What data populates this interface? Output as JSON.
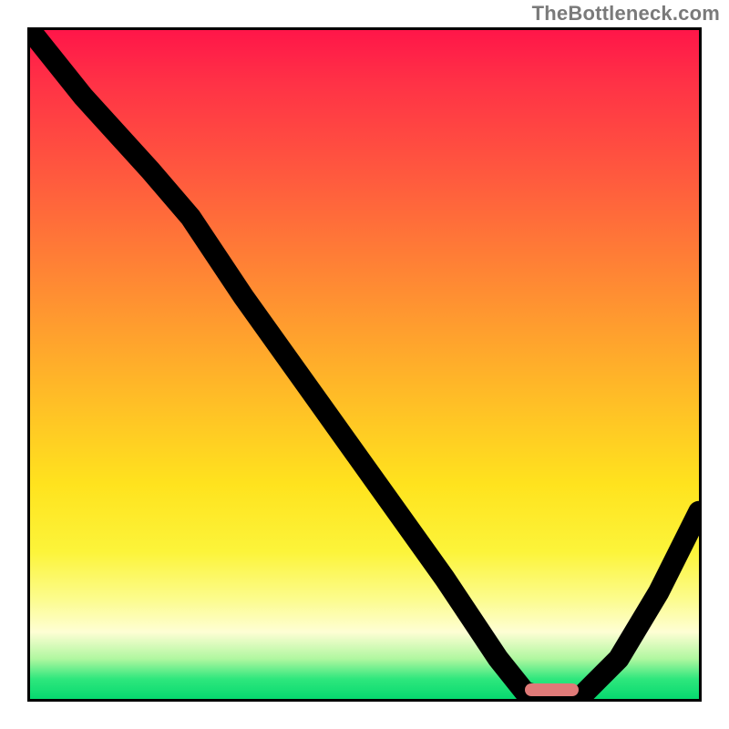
{
  "watermark": "TheBottleneck.com",
  "chart_data": {
    "type": "line",
    "title": "",
    "xlabel": "",
    "ylabel": "",
    "xlim": [
      0,
      100
    ],
    "ylim": [
      0,
      100
    ],
    "series": [
      {
        "name": "curve",
        "x": [
          0,
          8,
          18,
          24,
          32,
          42,
          52,
          62,
          70,
          74,
          78,
          82,
          88,
          94,
          100
        ],
        "values": [
          100,
          90,
          79,
          72,
          60,
          46,
          32,
          18,
          6,
          1,
          0,
          0,
          6,
          16,
          28
        ]
      }
    ],
    "marker": {
      "x_start": 74,
      "x_end": 82,
      "y": 0,
      "color": "#e07a78"
    },
    "gradient_stops": [
      {
        "pos": 0.0,
        "color": "#ff1649"
      },
      {
        "pos": 0.08,
        "color": "#ff3246"
      },
      {
        "pos": 0.22,
        "color": "#ff5a3e"
      },
      {
        "pos": 0.38,
        "color": "#ff8a33"
      },
      {
        "pos": 0.53,
        "color": "#ffb728"
      },
      {
        "pos": 0.68,
        "color": "#ffe31e"
      },
      {
        "pos": 0.78,
        "color": "#fcf43a"
      },
      {
        "pos": 0.85,
        "color": "#fcfc8c"
      },
      {
        "pos": 0.9,
        "color": "#fefed4"
      },
      {
        "pos": 0.94,
        "color": "#b0f7a0"
      },
      {
        "pos": 0.97,
        "color": "#2fe77d"
      },
      {
        "pos": 1.0,
        "color": "#06d96f"
      }
    ]
  }
}
